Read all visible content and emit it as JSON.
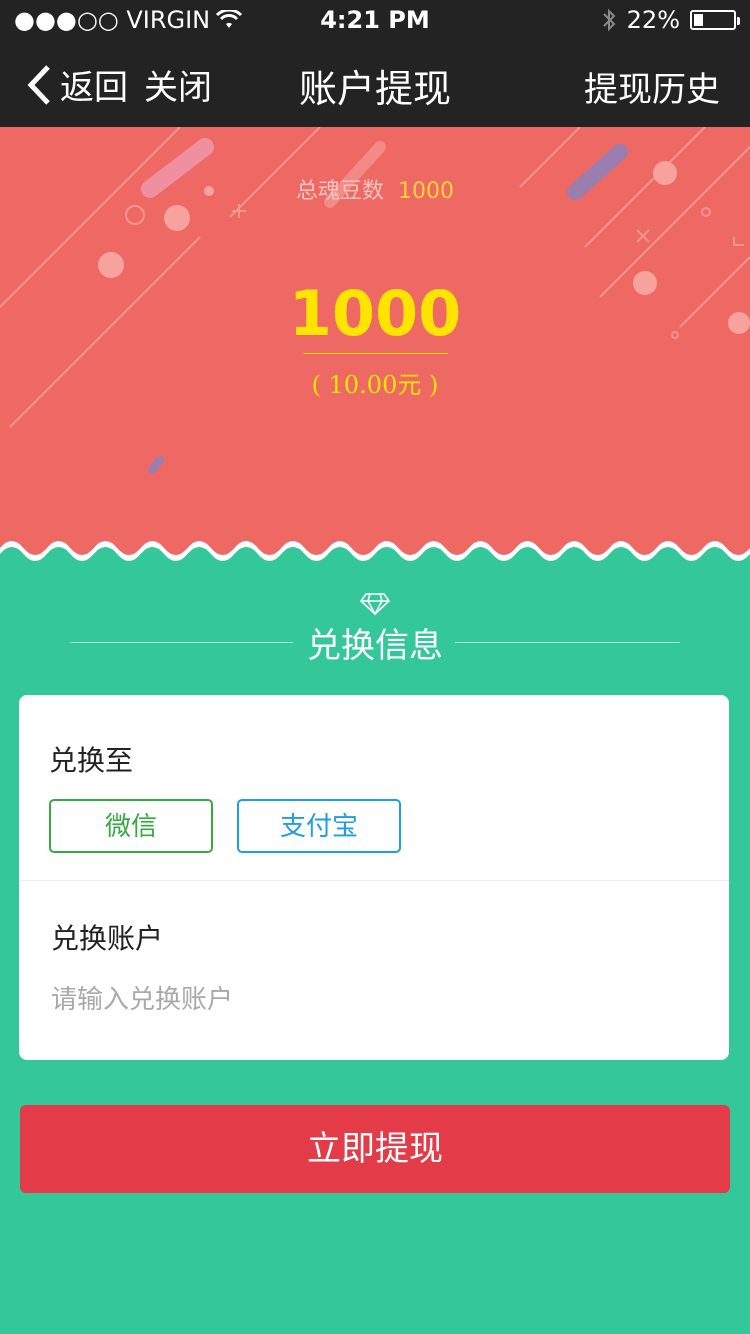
{
  "status_bar": {
    "carrier": "●●●○○ VIRGIN",
    "time": "4:21 PM",
    "battery": "22%",
    "battery_level": 0.22
  },
  "nav": {
    "back_label": "返回",
    "close_label": "关闭",
    "title": "账户提现",
    "history_label": "提现历史"
  },
  "hero": {
    "total_label": "总魂豆数",
    "total_value": "1000",
    "amount": "1000",
    "yuan": "( 10.00元 )"
  },
  "section": {
    "title": "兑换信息"
  },
  "form": {
    "exchange_to_label": "兑换至",
    "options": [
      "微信",
      "支付宝"
    ],
    "account_label": "兑换账户",
    "account_placeholder": "请输入兑换账户",
    "account_value": ""
  },
  "submit_label": "立即提现",
  "colors": {
    "nav_bg": "#232323",
    "hero_bg": "#ee6864",
    "page_bg": "#34c799",
    "amount": "#ffe400",
    "wechat": "#38a844",
    "alipay": "#1f9ee0",
    "submit_bg": "#e33b47"
  }
}
